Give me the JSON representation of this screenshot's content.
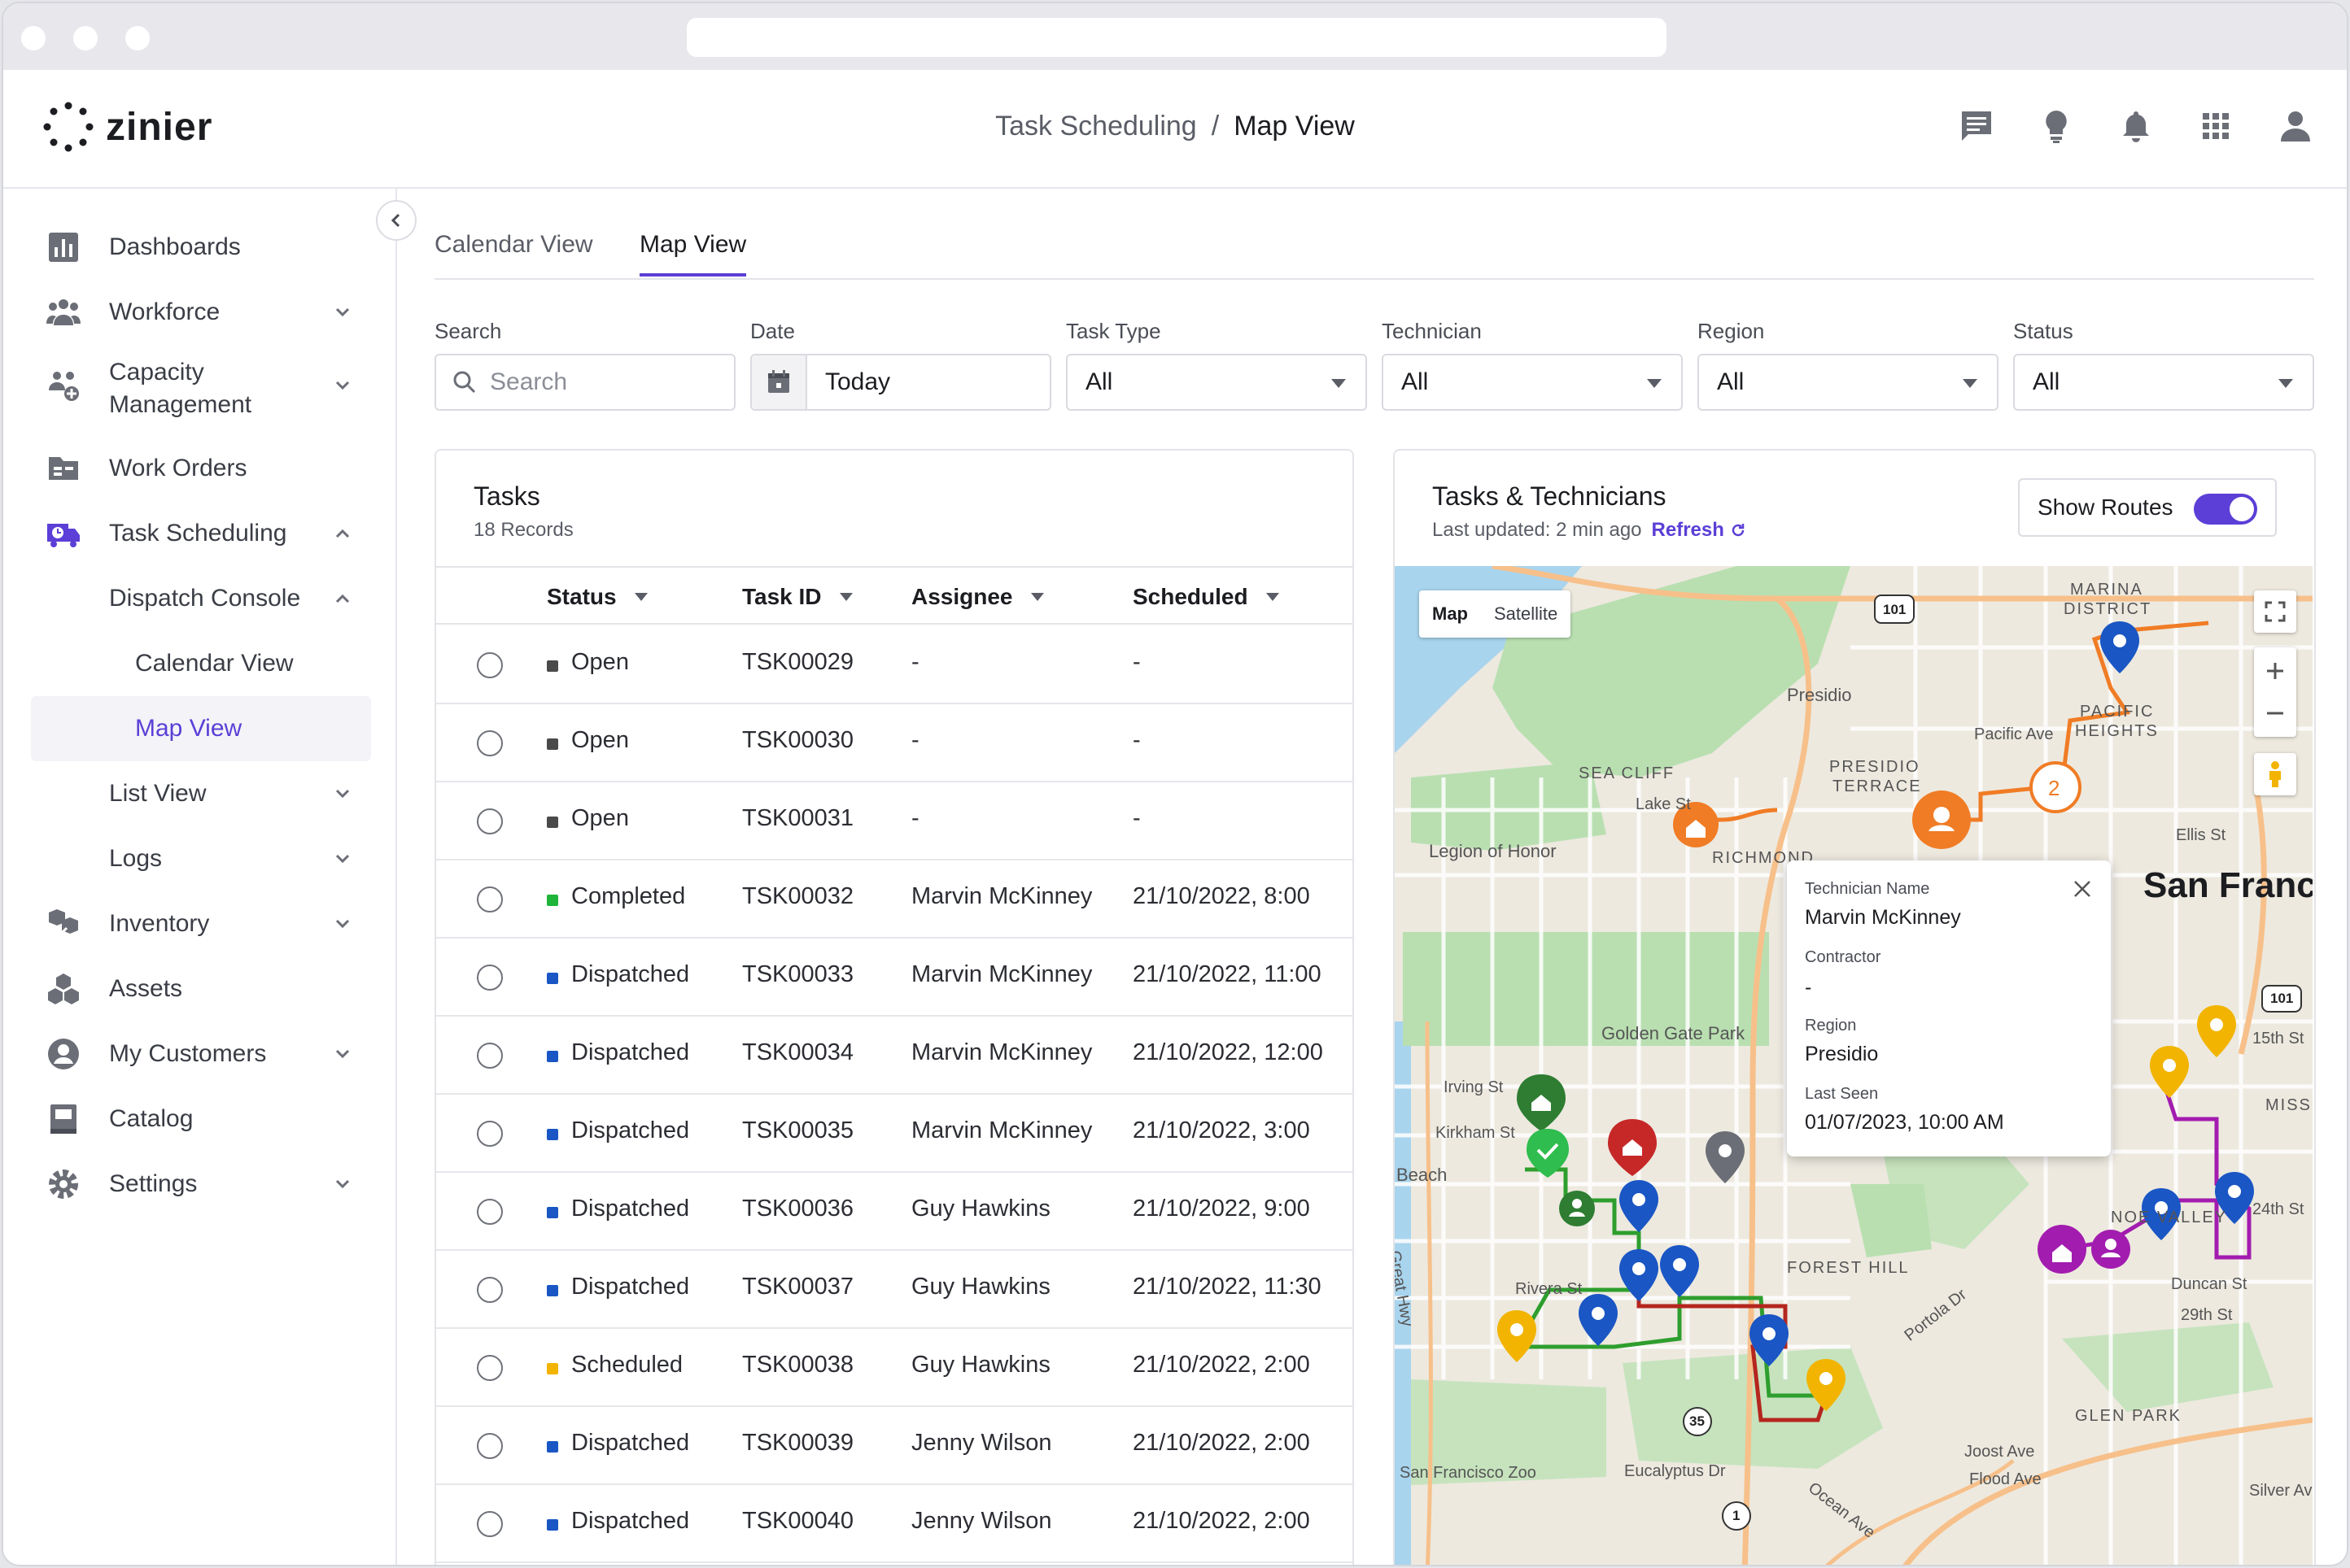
{
  "app": {
    "logo_text": "zinier"
  },
  "breadcrumb": {
    "parent": "Task Scheduling",
    "separator": "/",
    "current": "Map View"
  },
  "sidebar": {
    "items": [
      {
        "label": "Dashboards"
      },
      {
        "label": "Workforce"
      },
      {
        "label": "Capacity",
        "label2": "Management"
      },
      {
        "label": "Work Orders"
      },
      {
        "label": "Task Scheduling"
      },
      {
        "label": "Dispatch Console"
      },
      {
        "label": "Calendar View"
      },
      {
        "label": "Map View"
      },
      {
        "label": "List View"
      },
      {
        "label": "Logs"
      },
      {
        "label": "Inventory"
      },
      {
        "label": "Assets"
      },
      {
        "label": "My Customers"
      },
      {
        "label": "Catalog"
      },
      {
        "label": "Settings"
      }
    ]
  },
  "tabs": [
    {
      "label": "Calendar View"
    },
    {
      "label": "Map View"
    }
  ],
  "filters": {
    "search": {
      "label": "Search",
      "placeholder": "Search"
    },
    "date": {
      "label": "Date",
      "value": "Today"
    },
    "task_type": {
      "label": "Task Type",
      "value": "All"
    },
    "technician": {
      "label": "Technician",
      "value": "All"
    },
    "region": {
      "label": "Region",
      "value": "All"
    },
    "status": {
      "label": "Status",
      "value": "All"
    }
  },
  "tasks_panel": {
    "title": "Tasks",
    "records": "18 Records",
    "columns": [
      "Status",
      "Task ID",
      "Assignee",
      "Scheduled"
    ],
    "rows": [
      {
        "status": "Open",
        "color": "#4a4a4a",
        "id": "TSK00029",
        "assignee": "-",
        "scheduled": "-"
      },
      {
        "status": "Open",
        "color": "#4a4a4a",
        "id": "TSK00030",
        "assignee": "-",
        "scheduled": "-"
      },
      {
        "status": "Open",
        "color": "#4a4a4a",
        "id": "TSK00031",
        "assignee": "-",
        "scheduled": "-"
      },
      {
        "status": "Completed",
        "color": "#1eb53a",
        "id": "TSK00032",
        "assignee": "Marvin McKinney",
        "scheduled": "21/10/2022, 8:00"
      },
      {
        "status": "Dispatched",
        "color": "#1a56c4",
        "id": "TSK00033",
        "assignee": "Marvin McKinney",
        "scheduled": "21/10/2022, 11:00"
      },
      {
        "status": "Dispatched",
        "color": "#1a56c4",
        "id": "TSK00034",
        "assignee": "Marvin McKinney",
        "scheduled": "21/10/2022, 12:00"
      },
      {
        "status": "Dispatched",
        "color": "#1a56c4",
        "id": "TSK00035",
        "assignee": "Marvin McKinney",
        "scheduled": "21/10/2022, 3:00"
      },
      {
        "status": "Dispatched",
        "color": "#1a56c4",
        "id": "TSK00036",
        "assignee": "Guy Hawkins",
        "scheduled": "21/10/2022, 9:00"
      },
      {
        "status": "Dispatched",
        "color": "#1a56c4",
        "id": "TSK00037",
        "assignee": "Guy Hawkins",
        "scheduled": "21/10/2022, 11:30"
      },
      {
        "status": "Scheduled",
        "color": "#f2b400",
        "id": "TSK00038",
        "assignee": "Guy Hawkins",
        "scheduled": "21/10/2022, 2:00"
      },
      {
        "status": "Dispatched",
        "color": "#1a56c4",
        "id": "TSK00039",
        "assignee": "Jenny Wilson",
        "scheduled": "21/10/2022, 2:00"
      },
      {
        "status": "Dispatched",
        "color": "#1a56c4",
        "id": "TSK00040",
        "assignee": "Jenny Wilson",
        "scheduled": "21/10/2022, 2:00"
      }
    ]
  },
  "map_panel": {
    "title": "Tasks & Technicians",
    "last_updated": "Last updated: 2 min ago",
    "refresh": "Refresh",
    "show_routes": "Show Routes",
    "map_type": [
      "Map",
      "Satellite"
    ],
    "popup": {
      "tech_label": "Technician Name",
      "tech_value": "Marvin McKinney",
      "contractor_label": "Contractor",
      "contractor_value": "-",
      "region_label": "Region",
      "region_value": "Presidio",
      "seen_label": "Last Seen",
      "seen_value": "01/07/2023, 10:00 AM"
    },
    "labels": {
      "presidio": "Presidio",
      "marina": "MARINA",
      "district": "DISTRICT",
      "pacific": "PACIFIC",
      "heights": "HEIGHTS",
      "pacific_ave": "Pacific Ave",
      "presidio_terrace1": "PRESIDIO",
      "presidio_terrace2": "TERRACE",
      "sea_cliff": "SEA CLIFF",
      "lake_st": "Lake St",
      "legion": "Legion of Honor",
      "richmond": "RICHMOND",
      "san_fran": "San Franc",
      "golden_gate": "Golden Gate Park",
      "irving": "Irving St",
      "kirkham": "Kirkham St",
      "beach": "Beach",
      "rivera": "Rivera St",
      "forest_hill": "FOREST HILL",
      "portola": "Portola Dr",
      "glen_park": "GLEN PARK",
      "sf_zoo": "San Francisco Zoo",
      "eucalyptus": "Eucalyptus Dr",
      "joost": "Joost Ave",
      "flood": "Flood Ave",
      "silver": "Silver Ave",
      "mission": "MISSION",
      "noe": "NOE VALLEY",
      "duncan": "Duncan St",
      "st29": "29th St",
      "st15": "15th St",
      "st24": "24th St",
      "great_hwy": "Great Hwy",
      "ocean": "Ocean Ave",
      "ellis": "Ellis St",
      "hw101": "101",
      "hw35": "35",
      "hw1": "1",
      "cluster": "2"
    }
  },
  "colors": {
    "accent": "#5b3fd6",
    "blue_pin": "#1a56c4",
    "yellow_pin": "#f2b400",
    "green_route": "#2e9e2e",
    "red_route": "#b5261e",
    "purple_route": "#a21caf",
    "orange_route": "#f07c25"
  }
}
